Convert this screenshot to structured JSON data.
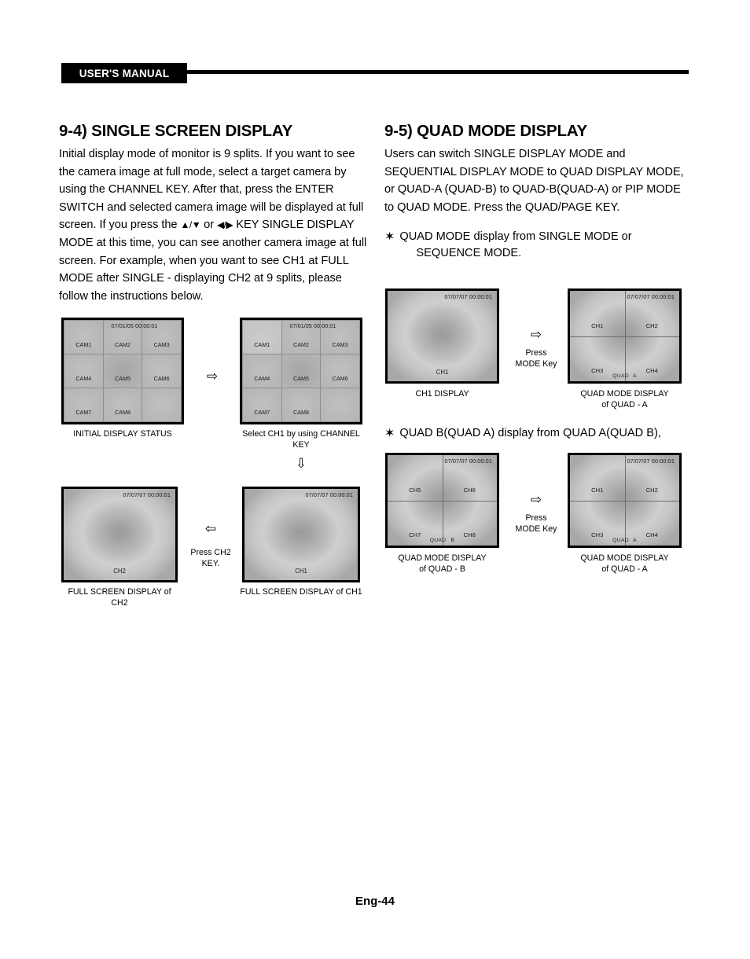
{
  "header": {
    "tag": "USER'S MANUAL"
  },
  "footer": {
    "page": "Eng-44"
  },
  "left_column": {
    "title": "9-4) SINGLE SCREEN DISPLAY",
    "body_1": "Initial display mode of monitor is 9 splits. If you want to see the camera image at full mode, select a target camera by using the CHANNEL KEY. After that, press the ENTER SWITCH and selected camera image will be displayed at full screen. If you press the ",
    "body_arrows_1": "▲/▼",
    "body_or": " or ",
    "body_arrows_2": "◀/▶",
    "body_2": " KEY SINGLE DISPLAY MODE at this time, you can see another camera image at full screen. For example, when you want to see CH1 at FULL MODE after SINGLE - displaying CH2 at 9 splits, please follow the instructions below."
  },
  "right_column": {
    "title": "9-5) QUAD MODE DISPLAY",
    "body": "Users can switch SINGLE DISPLAY MODE and SEQUENTIAL DISPLAY MODE to QUAD DISPLAY MODE, or QUAD-A (QUAD-B) to QUAD-B(QUAD-A) or PIP MODE to QUAD MODE. Press the QUAD/PAGE KEY.",
    "bullet_star": "✶",
    "bullet_1_line_1": "QUAD MODE display from SINGLE MODE or",
    "bullet_1_line_2": "SEQUENCE MODE.",
    "bullet_2": "QUAD B(QUAD A) display from QUAD A(QUAD B),"
  },
  "diagrams": {
    "nine_split_initial": {
      "timestamp": "07/01/05  00:00:01",
      "cells": [
        "CAM1",
        "CAM2",
        "CAM3",
        "CAM4",
        "CAM5",
        "CAM6",
        "CAM7",
        "CAM8",
        ""
      ],
      "caption": "INITIAL DISPLAY STATUS"
    },
    "nine_split_selected": {
      "timestamp": "07/01/05  00:00:01",
      "cells": [
        "CAM1",
        "CAM2",
        "CAM3",
        "CAM4",
        "CAM5",
        "CAM6",
        "CAM7",
        "CAM8",
        ""
      ],
      "caption_line_1": "Select CH1 by using CHANNEL",
      "caption_line_2": "KEY"
    },
    "full_ch2": {
      "timestamp": "07/07/07  00:00:01",
      "label": "CH2",
      "caption_line_1": "FULL SCREEN DISPLAY of",
      "caption_line_2": "CH2"
    },
    "full_ch1_left": {
      "timestamp": "07/07/07  00:00:01",
      "label": "CH1",
      "caption": "FULL SCREEN DISPLAY of CH1"
    },
    "full_ch1_right": {
      "timestamp": "07/07/07  00:00:01",
      "label": "CH1",
      "caption": "CH1 DISPLAY"
    },
    "quad_a_top": {
      "timestamp": "07/07/07  00:00:01",
      "cells": [
        "CH1",
        "CH2",
        "CH3",
        "CH4"
      ],
      "mode_prefix": "QUAD",
      "mode_letter": "A",
      "caption_line_1": "QUAD MODE DISPLAY",
      "caption_line_2": "of QUAD - A"
    },
    "quad_b": {
      "timestamp": "07/07/07  00:00:01",
      "cells": [
        "CH5",
        "CH6",
        "CH7",
        "CH8"
      ],
      "mode_prefix": "QUAD",
      "mode_letter": "B",
      "caption_line_1": "QUAD MODE DISPLAY",
      "caption_line_2": "of QUAD - B"
    },
    "quad_a_bottom": {
      "timestamp": "07/07/07  00:00:01",
      "cells": [
        "CH1",
        "CH2",
        "CH3",
        "CH4"
      ],
      "mode_prefix": "QUAD",
      "mode_letter": "A",
      "caption_line_1": "QUAD MODE DISPLAY",
      "caption_line_2": "of QUAD - A"
    }
  },
  "steps": {
    "arrow_right": "⇨",
    "arrow_left": "⇦",
    "arrow_down": "⇩",
    "press_ch2_line_1": "Press CH2",
    "press_ch2_line_2": "KEY.",
    "press_mode_line_1": "Press",
    "press_mode_line_2": "MODE Key"
  }
}
